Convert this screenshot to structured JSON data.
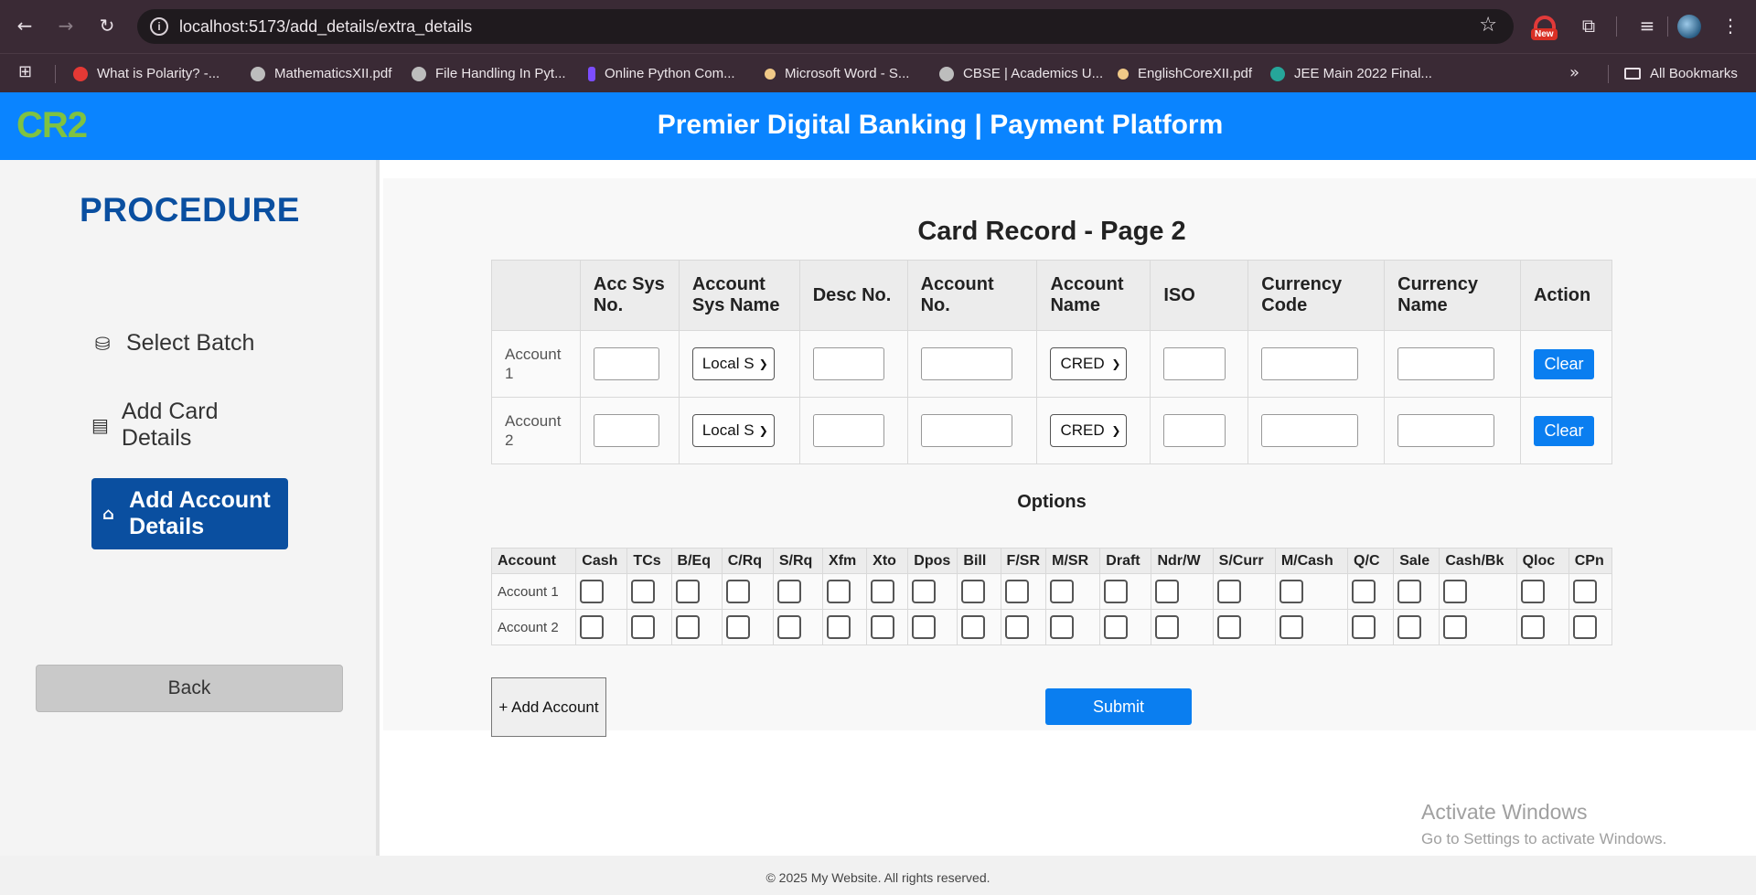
{
  "browser": {
    "url": "localhost:5173/add_details/extra_details",
    "new_badge": "New",
    "bookmarks": [
      {
        "label": "What is Polarity? -...",
        "color": "#e53935"
      },
      {
        "label": "MathematicsXII.pdf",
        "color": "#bdbdbd"
      },
      {
        "label": "File Handling In Pyt...",
        "color": "#bdbdbd"
      },
      {
        "label": "Online Python Com...",
        "color": "#7c4dff"
      },
      {
        "label": "Microsoft Word - S...",
        "color": "#f0c987"
      },
      {
        "label": "CBSE | Academics U...",
        "color": "#bdbdbd"
      },
      {
        "label": "EnglishCoreXII.pdf",
        "color": "#f0c987"
      },
      {
        "label": "JEE Main 2022 Final...",
        "color": "#26a69a"
      }
    ],
    "all_bookmarks": "All Bookmarks"
  },
  "header": {
    "logo": "CR2",
    "title": "Premier Digital Banking | Payment Platform"
  },
  "sidebar": {
    "title": "PROCEDURE",
    "steps": [
      {
        "label": "Select Batch",
        "icon": "jar-icon"
      },
      {
        "label": "Add Card Details",
        "icon": "id-card-icon"
      },
      {
        "label": "Add Account Details",
        "icon": "bank-icon"
      }
    ],
    "back_label": "Back"
  },
  "main": {
    "title": "Card Record - Page 2",
    "columns": [
      "",
      "Acc Sys No.",
      "Account Sys Name",
      "Desc No.",
      "Account No.",
      "Account Name",
      "ISO",
      "Currency Code",
      "Currency Name",
      "Action"
    ],
    "rows": [
      {
        "label": "Account 1",
        "sys_name": "Local S",
        "account_name": "CRED",
        "action": "Clear"
      },
      {
        "label": "Account 2",
        "sys_name": "Local S",
        "account_name": "CRED",
        "action": "Clear"
      }
    ],
    "options_title": "Options",
    "option_columns": [
      "Account",
      "Cash",
      "TCs",
      "B/Eq",
      "C/Rq",
      "S/Rq",
      "Xfm",
      "Xto",
      "Dpos",
      "Bill",
      "F/SR",
      "M/SR",
      "Draft",
      "Ndr/W",
      "S/Curr",
      "M/Cash",
      "Q/C",
      "Sale",
      "Cash/Bk",
      "Qloc",
      "CPn"
    ],
    "option_rows": [
      "Account 1",
      "Account 2"
    ],
    "add_account_label": "+ Add Account",
    "submit_label": "Submit"
  },
  "watermark": {
    "line1": "Activate Windows",
    "line2": "Go to Settings to activate Windows."
  },
  "footer": "© 2025 My Website. All rights reserved."
}
